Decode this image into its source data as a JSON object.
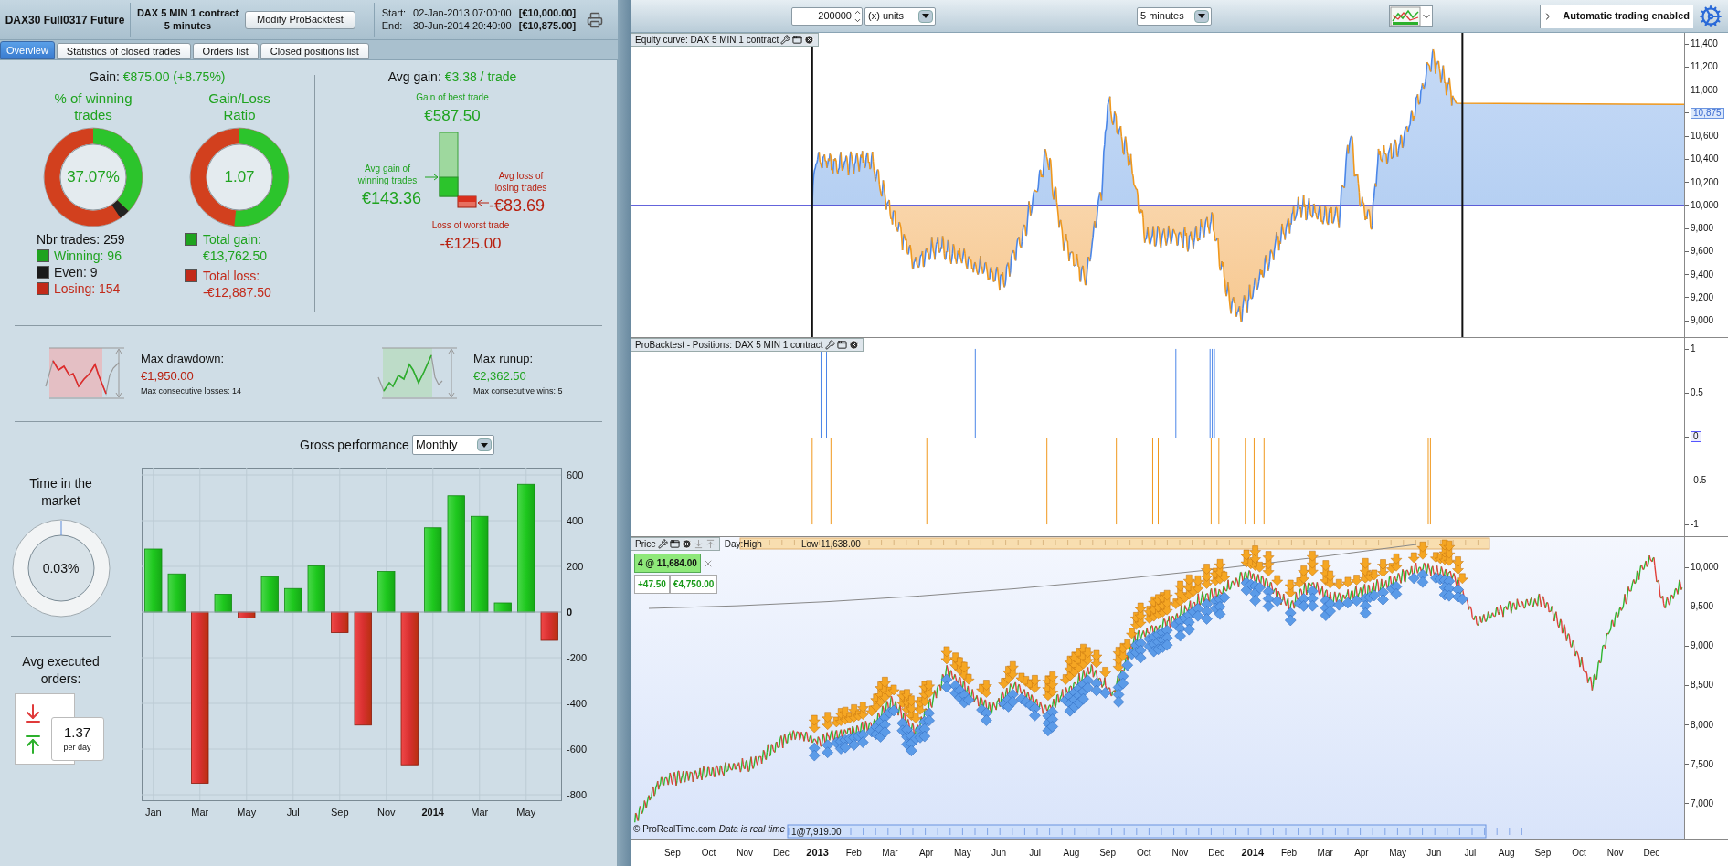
{
  "header": {
    "instrument": "DAX30 Full0317 Future",
    "system": "DAX 5 MIN 1 contract",
    "timeframe": "5 minutes",
    "modify_button": "Modify ProBacktest",
    "start_label": "Start:",
    "start_time": "02-Jan-2013 07:00:00",
    "start_capital": "[€10,000.00]",
    "end_label": "End:",
    "end_time": "30-Jun-2014 20:40:00",
    "end_capital": "[€10,875.00]"
  },
  "tabs": [
    {
      "label": "Overview",
      "selected": true
    },
    {
      "label": "Statistics of closed trades",
      "selected": false
    },
    {
      "label": "Orders list",
      "selected": false
    },
    {
      "label": "Closed positions list",
      "selected": false
    }
  ],
  "overview": {
    "gain_label": "Gain:",
    "gain_value": "€875.00 (+8.75%)",
    "win_donut": {
      "title": "% of winning trades",
      "value": "37.07%",
      "level": 0.3707
    },
    "ratio_donut": {
      "title": "Gain/Loss Ratio",
      "value": "1.07",
      "level": 0.516
    },
    "trades_total": "Nbr trades: 259",
    "trade_counts": [
      {
        "label": "Winning: 96",
        "color": "#1fa31f"
      },
      {
        "label": "Even: 9",
        "color": "#1a1a1a"
      },
      {
        "label": "Losing: 154",
        "color": "#c22a1a"
      }
    ],
    "totals": [
      {
        "label": "Total gain:",
        "value": "€13,762.50",
        "color": "#1fa31f"
      },
      {
        "label": "Total loss:",
        "value": "-€12,887.50",
        "color": "#c22a1a"
      }
    ],
    "avg_gain_label": "Avg gain:",
    "avg_gain_value": "€3.38 / trade",
    "best": {
      "label": "Gain of best trade",
      "value": "€587.50"
    },
    "avg_win": {
      "label": "Avg gain of winning trades",
      "value": "€143.36"
    },
    "avg_loss": {
      "label": "Avg loss of losing trades",
      "value": "-€83.69"
    },
    "worst": {
      "label": "Loss of worst trade",
      "value": "-€125.00"
    },
    "drawdown": {
      "title": "Max drawdown:",
      "value": "€1,950.00",
      "note": "Max consecutive losses: 14"
    },
    "runup": {
      "title": "Max runup:",
      "value": "€2,362.50",
      "note": "Max consecutive wins: 5"
    },
    "time_in_market": {
      "title": "Time in the market",
      "value": "0.03%"
    },
    "avg_orders": {
      "title": "Avg executed orders:",
      "value": "1.37",
      "unit": "per day"
    },
    "gross": {
      "title": "Gross performance",
      "period": "Monthly",
      "chart_data": {
        "type": "bar",
        "categories": [
          "Jan",
          null,
          "Mar",
          null,
          "May",
          null,
          "Jul",
          null,
          "Sep",
          null,
          "Nov",
          null,
          "2014",
          null,
          "Mar",
          null,
          "May",
          null
        ],
        "values": [
          276,
          167,
          -750,
          78,
          -26,
          155,
          103,
          202,
          -90,
          -495,
          178,
          -669,
          369,
          509,
          419,
          40,
          559,
          -124
        ],
        "ylim": [
          -824,
          632
        ],
        "yticks": [
          600,
          400,
          200,
          0,
          -200,
          -400,
          -600,
          -800
        ],
        "grid": true
      }
    }
  },
  "toolbar": {
    "quantity": "200000",
    "units": "(x) units",
    "timeframe": "5 minutes",
    "auto_trading": "Automatic trading enabled"
  },
  "equity": {
    "title": "Equity curve: DAX 5 MIN 1 contract",
    "yticks": [
      "11,400",
      "11,200",
      "11,000",
      "10,600",
      "10,400",
      "10,200",
      "10,000",
      "9,800",
      "9,600",
      "9,400",
      "9,200",
      "9,000"
    ],
    "current": "10,875"
  },
  "positions": {
    "title": "ProBacktest - Positions: DAX 5 MIN 1 contract",
    "yticks": [
      "1",
      "0.5",
      "0",
      "-0.5",
      "-1"
    ]
  },
  "price": {
    "title": "Price",
    "day_label": "Day:High",
    "day_low": "Low 11,638.00",
    "position": "4 @ 11,684.00",
    "points": "+47.50",
    "pnl": "€4,750.00",
    "entry_marker": "1@7,919.00",
    "copyright": "© ProRealTime.com",
    "realtime_note": "Data is real time",
    "yticks": [
      "10,000",
      "9,500",
      "9,000",
      "8,500",
      "8,000",
      "7,500",
      "7,000"
    ]
  },
  "time_axis": [
    {
      "label": "Sep",
      "bold": false
    },
    {
      "label": "Oct",
      "bold": false
    },
    {
      "label": "Nov",
      "bold": false
    },
    {
      "label": "Dec",
      "bold": false
    },
    {
      "label": "2013",
      "bold": true
    },
    {
      "label": "Feb",
      "bold": false
    },
    {
      "label": "Mar",
      "bold": false
    },
    {
      "label": "Apr",
      "bold": false
    },
    {
      "label": "May",
      "bold": false
    },
    {
      "label": "Jun",
      "bold": false
    },
    {
      "label": "Jul",
      "bold": false
    },
    {
      "label": "Aug",
      "bold": false
    },
    {
      "label": "Sep",
      "bold": false
    },
    {
      "label": "Oct",
      "bold": false
    },
    {
      "label": "Nov",
      "bold": false
    },
    {
      "label": "Dec",
      "bold": false
    },
    {
      "label": "2014",
      "bold": true
    },
    {
      "label": "Feb",
      "bold": false
    },
    {
      "label": "Mar",
      "bold": false
    },
    {
      "label": "Apr",
      "bold": false
    },
    {
      "label": "May",
      "bold": false
    },
    {
      "label": "Jun",
      "bold": false
    },
    {
      "label": "Jul",
      "bold": false
    },
    {
      "label": "Aug",
      "bold": false
    },
    {
      "label": "Sep",
      "bold": false
    },
    {
      "label": "Oct",
      "bold": false
    },
    {
      "label": "Nov",
      "bold": false
    },
    {
      "label": "Dec",
      "bold": false
    }
  ]
}
